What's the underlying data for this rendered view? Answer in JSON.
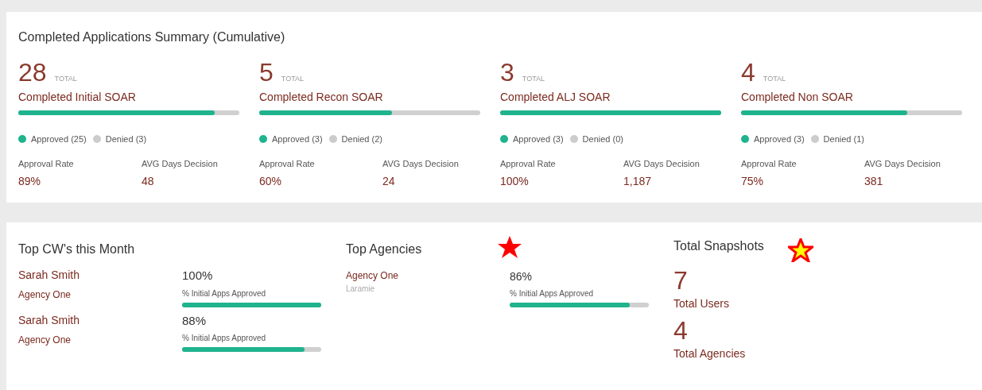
{
  "summary": {
    "title": "Completed Applications Summary (Cumulative)",
    "groups": [
      {
        "total": "28",
        "total_label": "TOTAL",
        "name": "Completed Initial SOAR",
        "level": 0.89,
        "approved": "Approved (25)",
        "denied": "Denied (3)",
        "rate_label": "Approval Rate",
        "rate": "89%",
        "days_label": "AVG Days Decision",
        "days": "48"
      },
      {
        "total": "5",
        "total_label": "TOTAL",
        "name": "Completed Recon SOAR",
        "level": 0.6,
        "approved": "Approved (3)",
        "denied": "Denied (2)",
        "rate_label": "Approval Rate",
        "rate": "60%",
        "days_label": "AVG Days Decision",
        "days": "24"
      },
      {
        "total": "3",
        "total_label": "TOTAL",
        "name": "Completed ALJ SOAR",
        "level": 1,
        "approved": "Approved (3)",
        "denied": "Denied (0)",
        "rate_label": "Approval Rate",
        "rate": "100%",
        "days_label": "AVG Days Decision",
        "days": "1,187"
      },
      {
        "total": "4",
        "total_label": "TOTAL",
        "name": "Completed Non SOAR",
        "level": 0.75,
        "approved": "Approved (3)",
        "denied": "Denied (1)",
        "rate_label": "Approval Rate",
        "rate": "75%",
        "days_label": "AVG Days Decision",
        "days": "381"
      }
    ]
  },
  "top_cws": {
    "title": "Top CW's this Month",
    "rows": [
      {
        "name": "Sarah Smith",
        "agency": "Agency One",
        "percent": "100%",
        "caption": "% Initial Apps Approved",
        "level": 1
      },
      {
        "name": "Sarah Smith",
        "agency": "Agency One",
        "percent": "88%",
        "caption": "% Initial Apps Approved",
        "level": 0.88
      }
    ]
  },
  "top_agencies": {
    "title": "Top Agencies",
    "marker": {
      "kind": "solid"
    },
    "rows": [
      {
        "name": "Agency One",
        "location": "Laramie",
        "percent": "86%",
        "caption": "% Initial Apps Approved",
        "level": 0.86
      }
    ]
  },
  "snapshots": {
    "title": "Total Snapshots",
    "marker": {
      "kind": "outlined"
    },
    "stats": [
      {
        "value": "7",
        "label": "Total Users"
      },
      {
        "value": "4",
        "label": "Total Agencies"
      }
    ]
  }
}
